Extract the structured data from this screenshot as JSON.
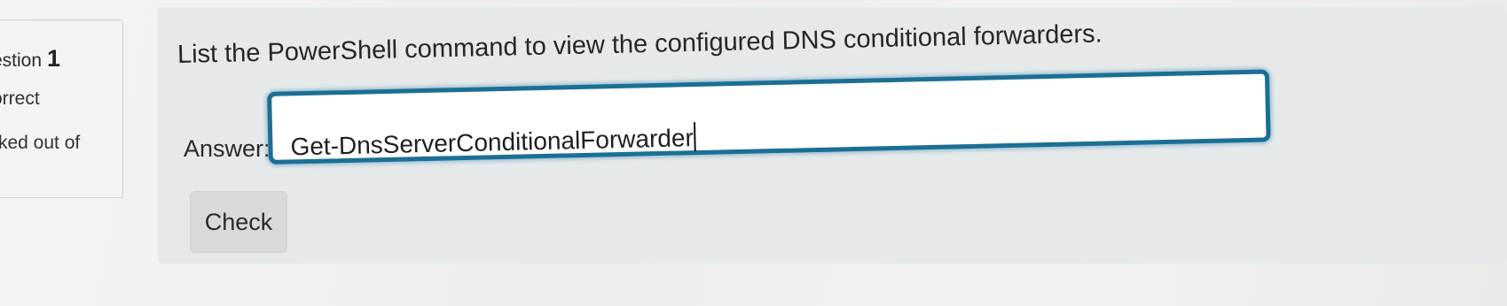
{
  "sidebar": {
    "question_label": "estion",
    "question_number": "1",
    "status": "orrect",
    "marks": "rked out of"
  },
  "question": {
    "text": "List the PowerShell command to view the configured DNS conditional forwarders.",
    "answer_label": "Answer:",
    "answer_value": "Get-DnsServerConditionalForwarder",
    "check_label": "Check"
  },
  "colors": {
    "focus_border": "#1b6f94",
    "panel_background": "#e6e9e9",
    "button_background": "#d7dada"
  }
}
